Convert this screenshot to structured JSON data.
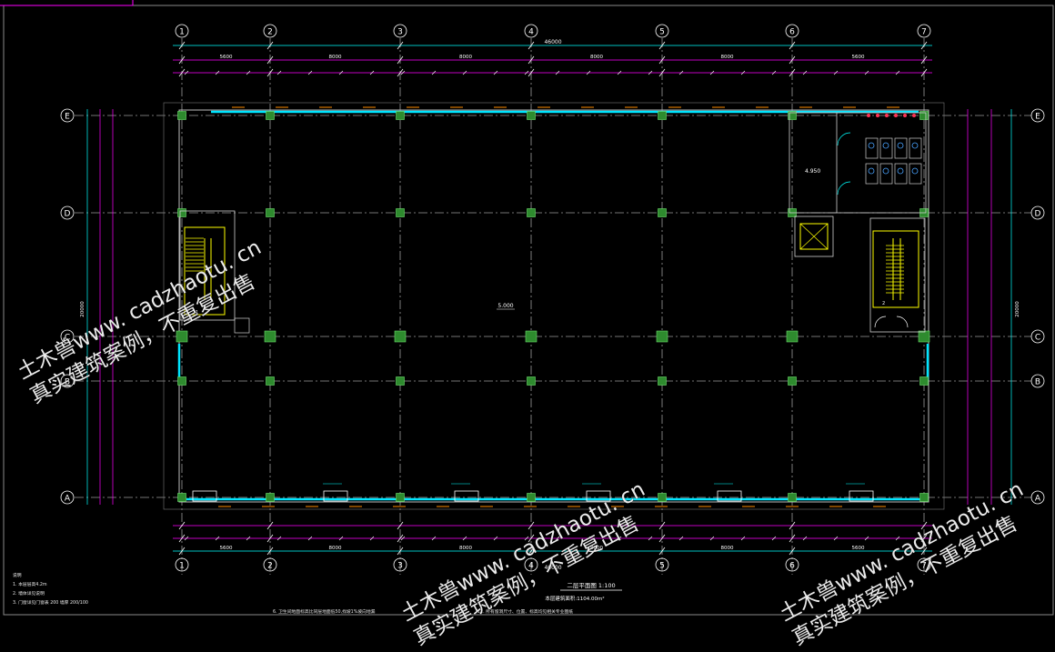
{
  "drawing": {
    "grid_cols": [
      "1",
      "2",
      "3",
      "4",
      "5",
      "6",
      "7"
    ],
    "grid_rows": [
      "E",
      "D",
      "C",
      "B",
      "A"
    ],
    "overall_dim": "46000",
    "bay_dims": [
      "5600",
      "8000",
      "8000",
      "8000",
      "8000",
      "5600"
    ],
    "overall_height": "20000",
    "floor_elev_main": "5.000",
    "floor_elev_toilet": "4.950",
    "plan_title": "二层平面图  1:100",
    "area_note": "本层建筑面积:1104.00m²",
    "stair_label_left": "1",
    "stair_label_right": "2",
    "notes": [
      "说明",
      "1. 本层层高4.2m",
      "2. 墙体详见说明",
      "3. 门窗详见门窗表     200   墙厚   200/100",
      "6. 卫生间地面标高比同层地面低50,找坡1%坡向地漏",
      "11. 所有留洞尺寸、位置、标高均见相关专业图纸"
    ],
    "colors": {
      "grid": "#00ffff",
      "dim": "#ff00ff",
      "column": "#2e8b2e",
      "wall": "#00e5ff",
      "stair": "#ffff00",
      "text_orange": "#ff8c00"
    }
  },
  "watermarks": [
    {
      "line1": "土木兽www. cadzhaotu. cn",
      "line2": "真实建筑案例，不重复出售"
    },
    {
      "line1": "土木兽www. cadzhaotu. cn",
      "line2": "真实建筑案例，不重复出售"
    },
    {
      "line1": "土木兽www. cadzhaotu. cn",
      "line2": "真实建筑案例，不重复出售"
    }
  ]
}
